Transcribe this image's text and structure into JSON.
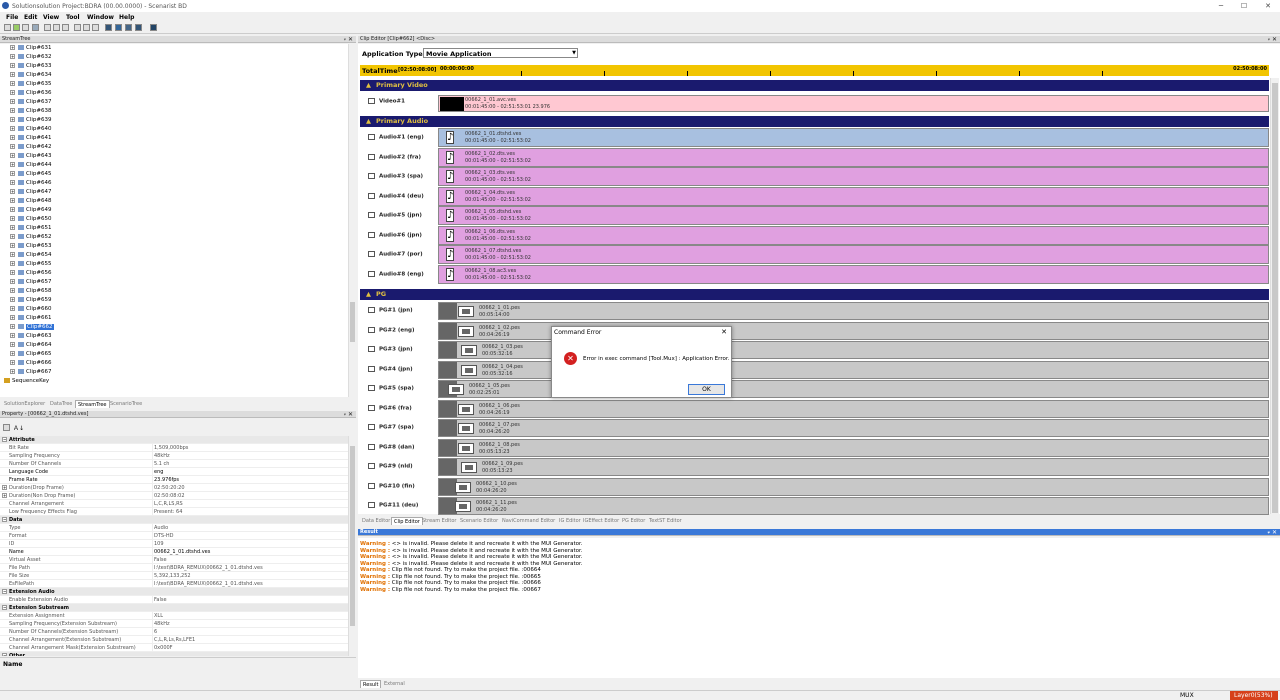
{
  "window": {
    "title": "Solutionsolution  Project:BDRA (00.00.0000) - Scenarist BD",
    "minimize": "─",
    "maximize": "☐",
    "close": "✕"
  },
  "menu": [
    "File",
    "Edit",
    "View",
    "Tool",
    "Window",
    "Help"
  ],
  "streamtree": {
    "title": "StreamTree",
    "pin": "ᵩ",
    "close": "✕",
    "clips": [
      "Clip#631",
      "Clip#632",
      "Clip#633",
      "Clip#634",
      "Clip#635",
      "Clip#636",
      "Clip#637",
      "Clip#638",
      "Clip#639",
      "Clip#640",
      "Clip#641",
      "Clip#642",
      "Clip#643",
      "Clip#644",
      "Clip#645",
      "Clip#646",
      "Clip#647",
      "Clip#648",
      "Clip#649",
      "Clip#650",
      "Clip#651",
      "Clip#652",
      "Clip#653",
      "Clip#654",
      "Clip#655",
      "Clip#656",
      "Clip#657",
      "Clip#658",
      "Clip#659",
      "Clip#660",
      "Clip#661",
      "Clip#662",
      "Clip#663",
      "Clip#664",
      "Clip#665",
      "Clip#666",
      "Clip#667"
    ],
    "selected": "Clip#662",
    "sequence_key": "SequenceKey",
    "tabs": [
      "SolutionExplorer",
      "DataTree",
      "StreamTree",
      "ScenarioTree"
    ],
    "active_tab": "StreamTree"
  },
  "property": {
    "title": "Property - [00662_1_01.dtshd.ves]",
    "pin": "ᵩ",
    "close": "✕",
    "sort_icon": "Ａ↓",
    "rows": [
      {
        "cat": true,
        "k": "Attribute"
      },
      {
        "k": "Bit Rate",
        "v": "1,509,000bps"
      },
      {
        "k": "Sampling Frequency",
        "v": "48kHz"
      },
      {
        "k": "Number Of Channels",
        "v": "5.1 ch"
      },
      {
        "k": "Language Code",
        "v": "eng",
        "bold": true
      },
      {
        "k": "Frame Rate",
        "v": "23.976fps",
        "bold": true
      },
      {
        "k": "Duration(Drop Frame)",
        "v": "02:50:20:20",
        "exp": true
      },
      {
        "k": "Duration(Non Drop Frame)",
        "v": "02:50:08:02",
        "exp": true
      },
      {
        "k": "Channel Arrangement",
        "v": "L,C,R,LS,RS"
      },
      {
        "k": "Low Frequency Effects Flag",
        "v": "Present: 64"
      },
      {
        "cat": true,
        "k": "Data"
      },
      {
        "k": "Type",
        "v": "Audio"
      },
      {
        "k": "Format",
        "v": "DTS-HD"
      },
      {
        "k": "ID",
        "v": "109"
      },
      {
        "k": "Name",
        "v": "00662_1_01.dtshd.ves",
        "bold": true
      },
      {
        "k": "Virtual Asset",
        "v": "False"
      },
      {
        "k": "File Path",
        "v": "I:\\test\\BDRA_REMUX\\00662_1_01.dtshd.ves"
      },
      {
        "k": "File Size",
        "v": "5,392,133,252"
      },
      {
        "k": "EsFilePath",
        "v": "I:\\test\\BDRA_REMUX\\00662_1_01.dtshd.ves"
      },
      {
        "cat": true,
        "k": "Extension Audio"
      },
      {
        "k": "Enable Extension Audio",
        "v": "False"
      },
      {
        "cat": true,
        "k": "Extension Substream"
      },
      {
        "k": "Extension Assignment",
        "v": "XLL"
      },
      {
        "k": "Sampling Frequency(Extension Substream)",
        "v": "48kHz"
      },
      {
        "k": "Number Of Channels(Extension Substream)",
        "v": "6"
      },
      {
        "k": "Channel Arrangement(Extension Substream)",
        "v": "C,L,R,Ls,Rs,LFE1"
      },
      {
        "k": "Channel Arrangement Mask(Extension Substream)",
        "v": "0x000F"
      },
      {
        "cat": true,
        "k": "Other"
      }
    ],
    "desc_title": "Name"
  },
  "clip_editor": {
    "title": "Clip Editor [Clip#662] <Disc>",
    "pin": "ᵩ",
    "close": "✕",
    "app_type_label": "Application Type :",
    "app_type_value": "Movie Application",
    "total_time_label": "TotalTime",
    "total_time_value": "[02:50:08:00]",
    "ruler_start": "00:00:00:00",
    "ruler_end": "02:50:08:00",
    "sections": {
      "video": "Primary Video",
      "audio": "Primary Audio",
      "pg": "PG"
    },
    "video": [
      {
        "name": "Video#1",
        "file": "00662_1_01.avc.ves",
        "time": "00:01:45:00 - 02:51:53:01  23.976"
      }
    ],
    "audio": [
      {
        "name": "Audio#1 (eng)",
        "file": "00662_1_01.dtshd.ves",
        "time": "00:01:45:00 - 02:51:53:02"
      },
      {
        "name": "Audio#2 (fra)",
        "file": "00662_1_02.dts.ves",
        "time": "00:01:45:00 - 02:51:53:02"
      },
      {
        "name": "Audio#3 (spa)",
        "file": "00662_1_03.dts.ves",
        "time": "00:01:45:00 - 02:51:53:02"
      },
      {
        "name": "Audio#4 (deu)",
        "file": "00662_1_04.dts.ves",
        "time": "00:01:45:00 - 02:51:53:02"
      },
      {
        "name": "Audio#5 (jpn)",
        "file": "00662_1_05.dtshd.ves",
        "time": "00:01:45:00 - 02:51:53:02"
      },
      {
        "name": "Audio#6 (jpn)",
        "file": "00662_1_06.dts.ves",
        "time": "00:01:45:00 - 02:51:53:02"
      },
      {
        "name": "Audio#7 (por)",
        "file": "00662_1_07.dtshd.ves",
        "time": "00:01:45:00 - 02:51:53:02"
      },
      {
        "name": "Audio#8 (eng)",
        "file": "00662_1_08.ac3.ves",
        "time": "00:01:45:00 - 02:51:53:02"
      }
    ],
    "pg": [
      {
        "name": "PG#1 (jpn)",
        "file": "00662_1_01.pes",
        "time": "00:05:14:00"
      },
      {
        "name": "PG#2 (eng)",
        "file": "00662_1_02.pes",
        "time": "00:04:26:19"
      },
      {
        "name": "PG#3 (jpn)",
        "file": "00662_1_03.pes",
        "time": "00:05:32:16"
      },
      {
        "name": "PG#4 (jpn)",
        "file": "00662_1_04.pes",
        "time": "00:05:32:16"
      },
      {
        "name": "PG#5 (spa)",
        "file": "00662_1_05.pes",
        "time": "00:02:25:01"
      },
      {
        "name": "PG#6 (fra)",
        "file": "00662_1_06.pes",
        "time": "00:04:26:19"
      },
      {
        "name": "PG#7 (spa)",
        "file": "00662_1_07.pes",
        "time": "00:04:26:20"
      },
      {
        "name": "PG#8 (dan)",
        "file": "00662_1_08.pes",
        "time": "00:05:13:23"
      },
      {
        "name": "PG#9 (nld)",
        "file": "00662_1_09.pes",
        "time": "00:05:13:23"
      },
      {
        "name": "PG#10 (fin)",
        "file": "00662_1_10.pes",
        "time": "00:04:26:20"
      },
      {
        "name": "PG#11 (deu)",
        "file": "00662_1_11.pes",
        "time": "00:04:26:20"
      }
    ],
    "tabs": [
      "Data Editor",
      "Clip Editor",
      "Stream Editor",
      "Scenario Editor",
      "NaviCommand Editor",
      "IG Editor",
      "IGEffect Editor",
      "PG Editor",
      "TextST Editor"
    ],
    "active_tab": "Clip Editor"
  },
  "result": {
    "title": "Result",
    "pin": "ᵩ",
    "close": "✕",
    "lines": [
      {
        "w": "Warning :",
        "t": " <> is invalid. Please delete it and recreate it with the MUI Generator."
      },
      {
        "w": "Warning :",
        "t": " <> is invalid. Please delete it and recreate it with the MUI Generator."
      },
      {
        "w": "Warning :",
        "t": " <> is invalid. Please delete it and recreate it with the MUI Generator."
      },
      {
        "w": "Warning :",
        "t": " <> is invalid. Please delete it and recreate it with the MUI Generator."
      },
      {
        "w": "Warning :",
        "t": " Clip file not found. Try to make the project file. :00664"
      },
      {
        "w": "Warning :",
        "t": " Clip file not found. Try to make the project file. :00665"
      },
      {
        "w": "Warning :",
        "t": " Clip file not found. Try to make the project file. :00666"
      },
      {
        "w": "Warning :",
        "t": " Clip file not found. Try to make the project file. :00667"
      }
    ],
    "tabs": [
      "Result",
      "External"
    ],
    "active_tab": "Result"
  },
  "dialog": {
    "title": "Command Error",
    "message": "Error in exec command [Tool.Mux] : Application Error.",
    "ok": "OK",
    "close": "✕",
    "icon": "✕"
  },
  "status": {
    "mode": "MUX",
    "layer": "Layer0(53%)"
  }
}
